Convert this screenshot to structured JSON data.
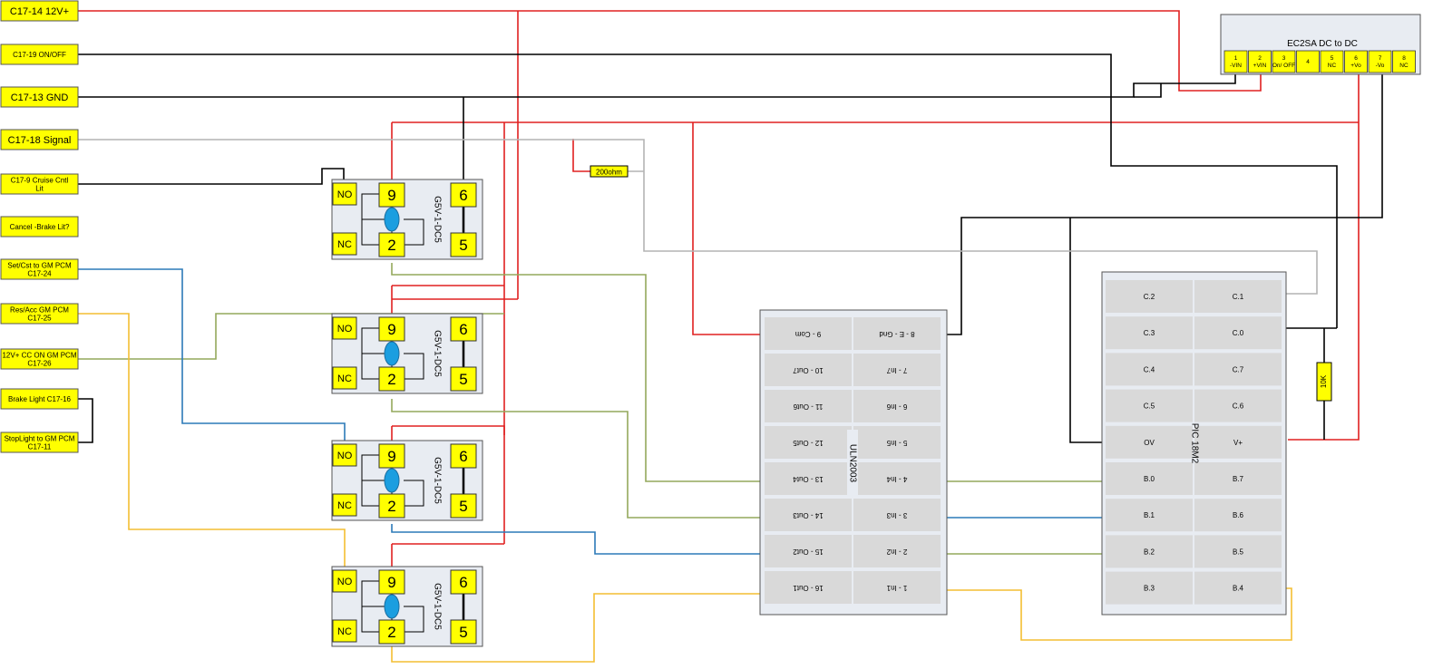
{
  "colors": {
    "red": "#e02020",
    "black": "#000000",
    "gray": "#b4b4b4",
    "green": "#94a85c",
    "blue": "#2c7ab8",
    "yellow": "#f4be32",
    "labelFill": "#ffff00",
    "moduleFill": "#e8ecf2",
    "pinFill": "#d9d9d9",
    "coil": "#1b9ee0"
  },
  "connectors": [
    "C17-14 12V+",
    "C17-19 ON/OFF",
    "C17-13 GND",
    "C17-18 Signal",
    "C17-9 Cruise Cntl Lit",
    "Cancel -Brake Lit?",
    "Set/Cst to GM PCM C17-24",
    "Res/Acc GM PCM C17-25",
    "12V+ CC ON GM PCM C17-26",
    "Brake Light C17-16",
    "StopLight to GM PCM C17-11"
  ],
  "relays": [
    {
      "part": "G5V-1-DC5",
      "no": "NO",
      "nc": "NC",
      "pins": [
        "9",
        "2",
        "6",
        "5"
      ]
    },
    {
      "part": "G5V-1-DC5",
      "no": "NO",
      "nc": "NC",
      "pins": [
        "9",
        "2",
        "6",
        "5"
      ]
    },
    {
      "part": "G5V-1-DC5",
      "no": "NO",
      "nc": "NC",
      "pins": [
        "9",
        "2",
        "6",
        "5"
      ]
    },
    {
      "part": "G5V-1-DC5",
      "no": "NO",
      "nc": "NC",
      "pins": [
        "9",
        "2",
        "6",
        "5"
      ]
    }
  ],
  "resistors": [
    "200ohm",
    "10K"
  ],
  "converter": {
    "title": "EC2SA DC to DC",
    "pins": [
      "1 -VIN",
      "2 +VIN",
      "3 On/ OFF",
      "4",
      "5 NC",
      "6 +Vo",
      "7 -Vo",
      "8 NC"
    ]
  },
  "uln": {
    "name": "ULN2003",
    "left": [
      "9 - Com",
      "10 - Out7",
      "11 - Out6",
      "12 - Out5",
      "13 - Out4",
      "14 - Out3",
      "15 - Out2",
      "16 - Out1"
    ],
    "right": [
      "8 - E - Gnd",
      "7 - In7",
      "6 - In6",
      "5 - In5",
      "4 - In4",
      "3 - In3",
      "2 - In2",
      "1 - In1"
    ]
  },
  "pic": {
    "name": "PIC 18M2",
    "left": [
      "C.2",
      "C.3",
      "C.4",
      "C.5",
      "OV",
      "B.0",
      "B.1",
      "B.2",
      "B.3"
    ],
    "right": [
      "C.1",
      "C.0",
      "C.7",
      "C.6",
      "V+",
      "B.7",
      "B.6",
      "B.5",
      "B.4"
    ]
  }
}
